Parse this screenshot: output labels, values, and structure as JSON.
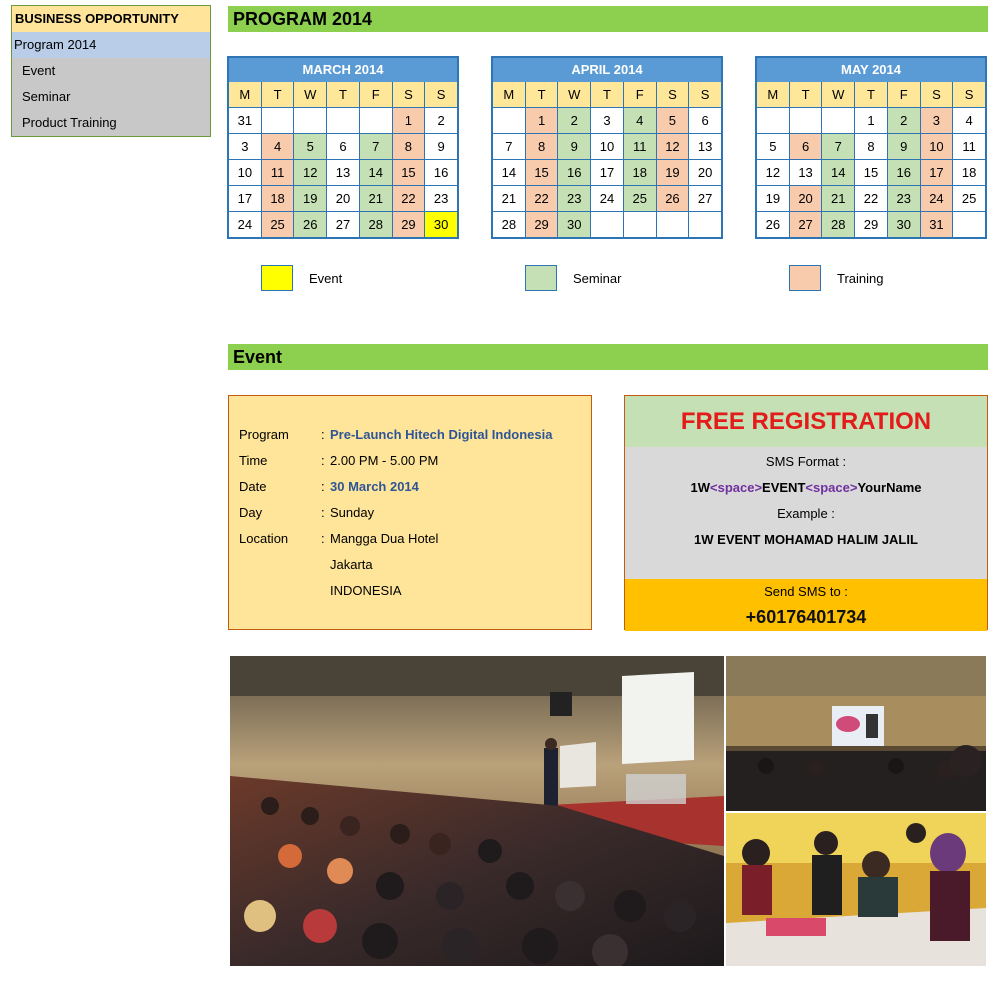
{
  "sidebar": {
    "header": "BUSINESS OPPORTUNITY",
    "active": "Program 2014",
    "items": [
      "Event",
      "Seminar",
      "Product Training"
    ]
  },
  "program_header": "PROGRAM 2014",
  "event_header": "Event",
  "dow": [
    "M",
    "T",
    "W",
    "T",
    "F",
    "S",
    "S"
  ],
  "calendars": [
    {
      "title": "MARCH 2014",
      "weeks": [
        [
          {
            "d": "31",
            "t": ""
          },
          {
            "d": "",
            "t": ""
          },
          {
            "d": "",
            "t": ""
          },
          {
            "d": "",
            "t": ""
          },
          {
            "d": "",
            "t": ""
          },
          {
            "d": "1",
            "t": "training"
          },
          {
            "d": "2",
            "t": ""
          }
        ],
        [
          {
            "d": "3",
            "t": ""
          },
          {
            "d": "4",
            "t": "training"
          },
          {
            "d": "5",
            "t": "seminar"
          },
          {
            "d": "6",
            "t": ""
          },
          {
            "d": "7",
            "t": "seminar"
          },
          {
            "d": "8",
            "t": "training"
          },
          {
            "d": "9",
            "t": ""
          }
        ],
        [
          {
            "d": "10",
            "t": ""
          },
          {
            "d": "11",
            "t": "training"
          },
          {
            "d": "12",
            "t": "seminar"
          },
          {
            "d": "13",
            "t": ""
          },
          {
            "d": "14",
            "t": "seminar"
          },
          {
            "d": "15",
            "t": "training"
          },
          {
            "d": "16",
            "t": ""
          }
        ],
        [
          {
            "d": "17",
            "t": ""
          },
          {
            "d": "18",
            "t": "training"
          },
          {
            "d": "19",
            "t": "seminar"
          },
          {
            "d": "20",
            "t": ""
          },
          {
            "d": "21",
            "t": "seminar"
          },
          {
            "d": "22",
            "t": "training"
          },
          {
            "d": "23",
            "t": ""
          }
        ],
        [
          {
            "d": "24",
            "t": ""
          },
          {
            "d": "25",
            "t": "training"
          },
          {
            "d": "26",
            "t": "seminar"
          },
          {
            "d": "27",
            "t": ""
          },
          {
            "d": "28",
            "t": "seminar"
          },
          {
            "d": "29",
            "t": "training"
          },
          {
            "d": "30",
            "t": "event"
          }
        ]
      ]
    },
    {
      "title": "APRIL 2014",
      "weeks": [
        [
          {
            "d": "",
            "t": ""
          },
          {
            "d": "1",
            "t": "training"
          },
          {
            "d": "2",
            "t": "seminar"
          },
          {
            "d": "3",
            "t": ""
          },
          {
            "d": "4",
            "t": "seminar"
          },
          {
            "d": "5",
            "t": "training"
          },
          {
            "d": "6",
            "t": ""
          }
        ],
        [
          {
            "d": "7",
            "t": ""
          },
          {
            "d": "8",
            "t": "training"
          },
          {
            "d": "9",
            "t": "seminar"
          },
          {
            "d": "10",
            "t": ""
          },
          {
            "d": "11",
            "t": "seminar"
          },
          {
            "d": "12",
            "t": "training"
          },
          {
            "d": "13",
            "t": ""
          }
        ],
        [
          {
            "d": "14",
            "t": ""
          },
          {
            "d": "15",
            "t": "training"
          },
          {
            "d": "16",
            "t": "seminar"
          },
          {
            "d": "17",
            "t": ""
          },
          {
            "d": "18",
            "t": "seminar"
          },
          {
            "d": "19",
            "t": "training"
          },
          {
            "d": "20",
            "t": ""
          }
        ],
        [
          {
            "d": "21",
            "t": ""
          },
          {
            "d": "22",
            "t": "training"
          },
          {
            "d": "23",
            "t": "seminar"
          },
          {
            "d": "24",
            "t": ""
          },
          {
            "d": "25",
            "t": "seminar"
          },
          {
            "d": "26",
            "t": "training"
          },
          {
            "d": "27",
            "t": ""
          }
        ],
        [
          {
            "d": "28",
            "t": ""
          },
          {
            "d": "29",
            "t": "training"
          },
          {
            "d": "30",
            "t": "seminar"
          },
          {
            "d": "",
            "t": ""
          },
          {
            "d": "",
            "t": ""
          },
          {
            "d": "",
            "t": ""
          },
          {
            "d": "",
            "t": ""
          }
        ]
      ]
    },
    {
      "title": "MAY 2014",
      "weeks": [
        [
          {
            "d": "",
            "t": ""
          },
          {
            "d": "",
            "t": ""
          },
          {
            "d": "",
            "t": ""
          },
          {
            "d": "1",
            "t": ""
          },
          {
            "d": "2",
            "t": "seminar"
          },
          {
            "d": "3",
            "t": "training"
          },
          {
            "d": "4",
            "t": ""
          }
        ],
        [
          {
            "d": "5",
            "t": ""
          },
          {
            "d": "6",
            "t": "training"
          },
          {
            "d": "7",
            "t": "seminar"
          },
          {
            "d": "8",
            "t": ""
          },
          {
            "d": "9",
            "t": "seminar"
          },
          {
            "d": "10",
            "t": "training"
          },
          {
            "d": "11",
            "t": ""
          }
        ],
        [
          {
            "d": "12",
            "t": ""
          },
          {
            "d": "13",
            "t": ""
          },
          {
            "d": "14",
            "t": "seminar"
          },
          {
            "d": "15",
            "t": ""
          },
          {
            "d": "16",
            "t": "seminar"
          },
          {
            "d": "17",
            "t": "training"
          },
          {
            "d": "18",
            "t": ""
          }
        ],
        [
          {
            "d": "19",
            "t": ""
          },
          {
            "d": "20",
            "t": "training"
          },
          {
            "d": "21",
            "t": "seminar"
          },
          {
            "d": "22",
            "t": ""
          },
          {
            "d": "23",
            "t": "seminar"
          },
          {
            "d": "24",
            "t": "training"
          },
          {
            "d": "25",
            "t": ""
          }
        ],
        [
          {
            "d": "26",
            "t": ""
          },
          {
            "d": "27",
            "t": "training"
          },
          {
            "d": "28",
            "t": "seminar"
          },
          {
            "d": "29",
            "t": ""
          },
          {
            "d": "30",
            "t": "seminar"
          },
          {
            "d": "31",
            "t": "training"
          },
          {
            "d": "",
            "t": ""
          }
        ]
      ]
    }
  ],
  "legend": [
    {
      "label": "Event",
      "color": "#ffff00"
    },
    {
      "label": "Seminar",
      "color": "#c5e0b4"
    },
    {
      "label": "Training",
      "color": "#f8cbad"
    }
  ],
  "event_info": {
    "colon": ":",
    "rows": [
      {
        "label": "Program",
        "value": "Pre-Launch Hitech Digital Indonesia"
      },
      {
        "label": "Time",
        "value": "2.00 PM - 5.00 PM"
      },
      {
        "label": "Date",
        "value": "30 March 2014"
      },
      {
        "label": "Day",
        "value": "Sunday"
      },
      {
        "label": "Location",
        "value": "Mangga Dua Hotel"
      }
    ],
    "location_extra": [
      "Jakarta",
      "INDONESIA"
    ]
  },
  "registration": {
    "title": "FREE REGISTRATION",
    "sms_format_label": "SMS Format :",
    "format_prefix": "1W",
    "space_token": "<space>",
    "format_event": "EVENT",
    "format_suffix": "YourName",
    "example_label": "Example :",
    "example_text": "1W EVENT MOHAMAD HALIM JALIL",
    "send_label": "Send SMS to :",
    "phone": "+60176401734"
  },
  "colors": {
    "header_green": "#8dd04f",
    "calendar_blue": "#2e75b6",
    "event_yellow": "#ffff00",
    "seminar_green": "#c5e0b4",
    "training_peach": "#f8cbad",
    "info_yellow": "#ffe599",
    "reg_red": "#e31b1b",
    "reg_orange": "#ffc000"
  }
}
